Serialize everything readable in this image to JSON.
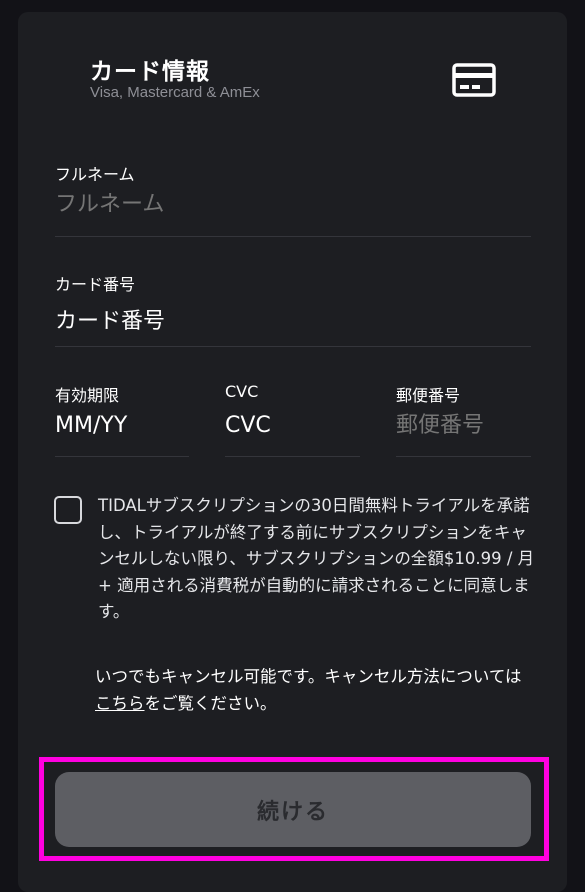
{
  "header": {
    "title": "カード情報",
    "subtitle": "Visa, Mastercard & AmEx",
    "icon": "credit-card-icon"
  },
  "form": {
    "full_name": {
      "label": "フルネーム",
      "placeholder": "フルネーム",
      "value": ""
    },
    "card_number": {
      "label": "カード番号",
      "value": "カード番号"
    },
    "expiry": {
      "label": "有効期限",
      "value": "MM/YY"
    },
    "cvc": {
      "label": "CVC",
      "value": "CVC"
    },
    "postal_code": {
      "label": "郵便番号",
      "placeholder": "郵便番号",
      "value": ""
    }
  },
  "terms": {
    "checked": false,
    "text": "TIDALサブスクリプションの30日間無料トライアルを承諾し、トライアルが終了する前にサブスクリプションをキャンセルしない限り、サブスクリプションの全額$10.99 / 月 + 適用される消費税が自動的に請求されることに同意します。"
  },
  "cancel_note": {
    "prefix": "いつでもキャンセル可能です。キャンセル方法については",
    "link": "こちら",
    "suffix": "をご覧ください。"
  },
  "actions": {
    "continue_label": "続ける"
  },
  "colors": {
    "background": "#121217",
    "card": "#1d1e22",
    "highlight": "#ff00e0",
    "button": "#5d5e63"
  }
}
